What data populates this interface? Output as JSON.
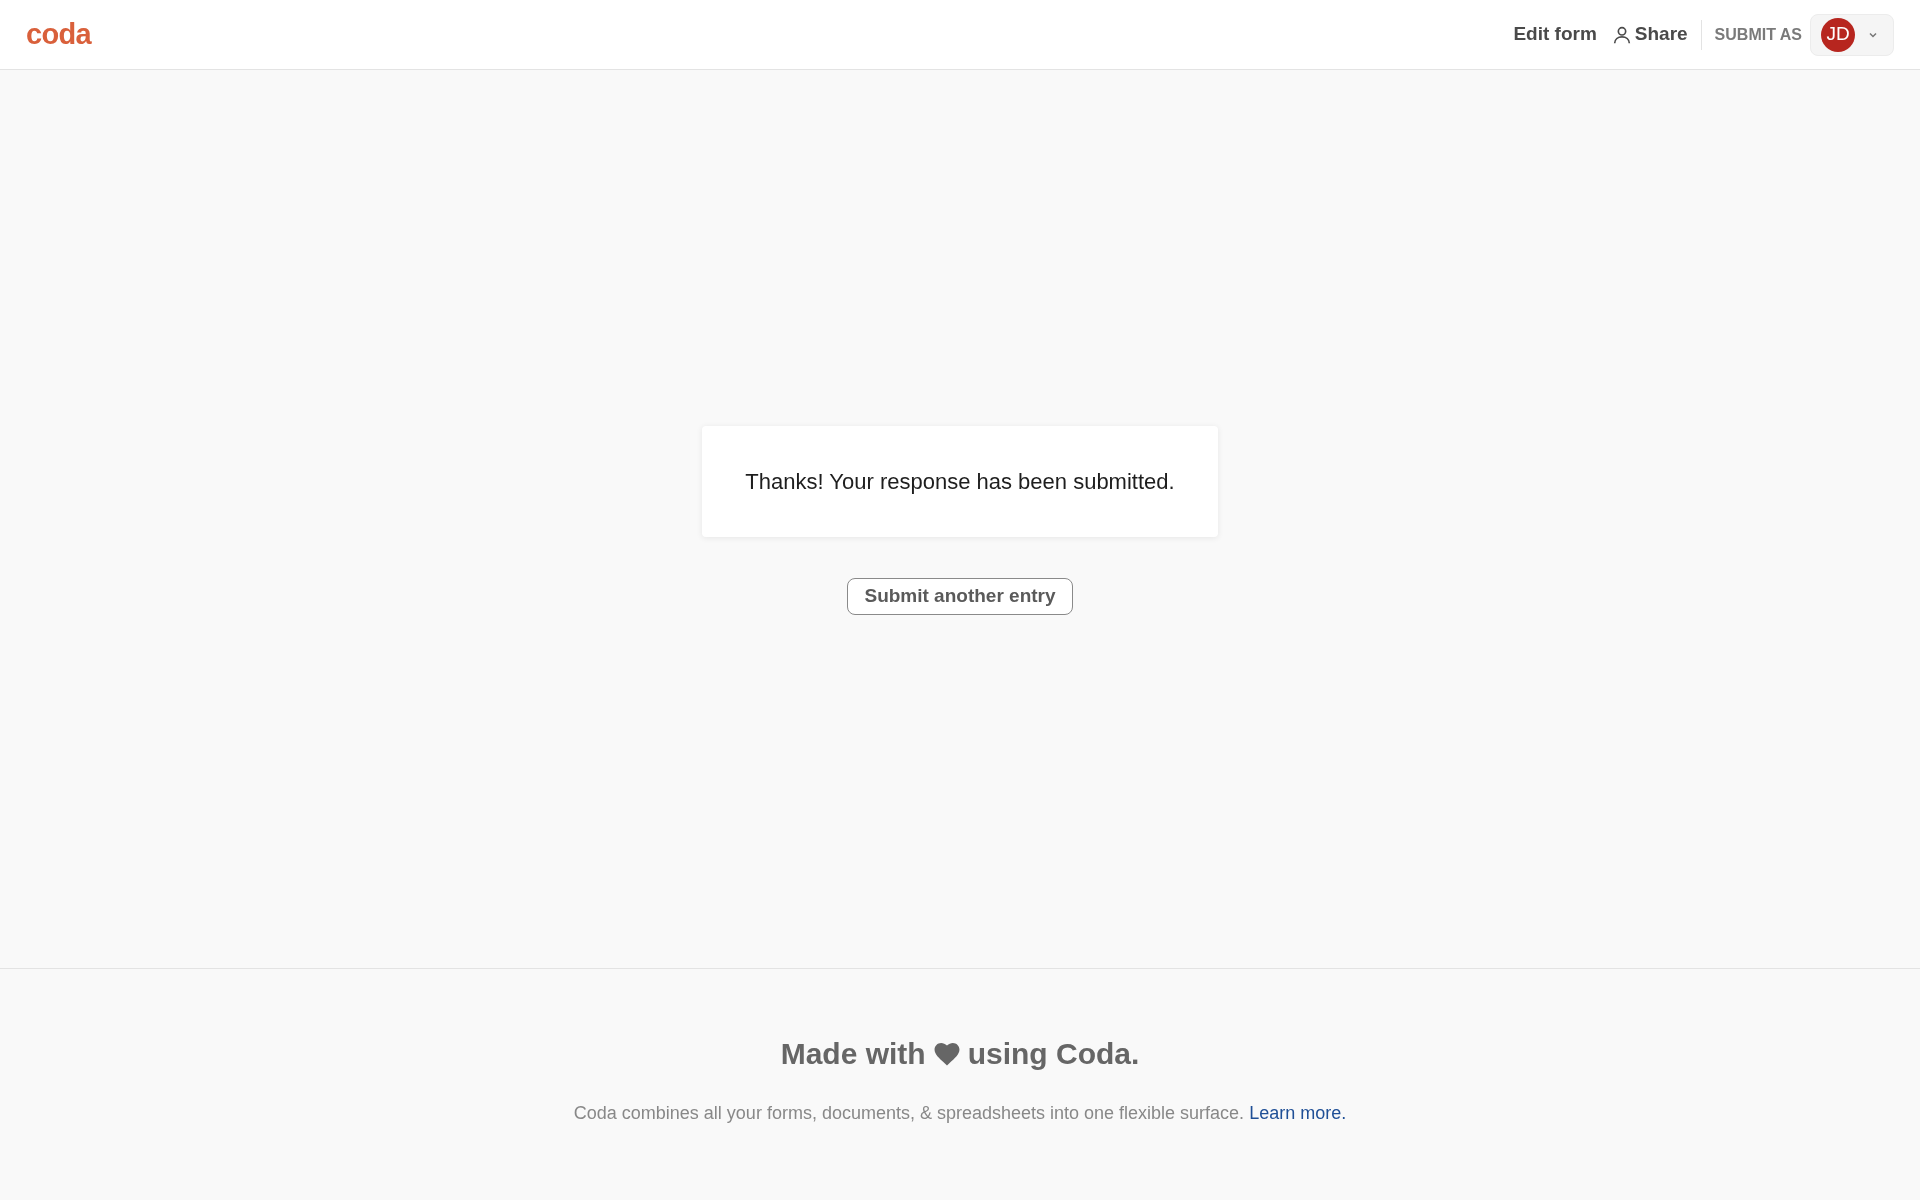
{
  "header": {
    "logo": "coda",
    "edit_form": "Edit form",
    "share": "Share",
    "submit_as": "SUBMIT AS",
    "avatar_initials": "JD"
  },
  "confirmation": {
    "message": "Thanks! Your response has been submitted.",
    "button": "Submit another entry"
  },
  "footer": {
    "heading_before": "Made with",
    "heading_after": "using Coda.",
    "text": "Coda combines all your forms, documents, & spreadsheets into one flexible surface.",
    "link": "Learn more."
  }
}
